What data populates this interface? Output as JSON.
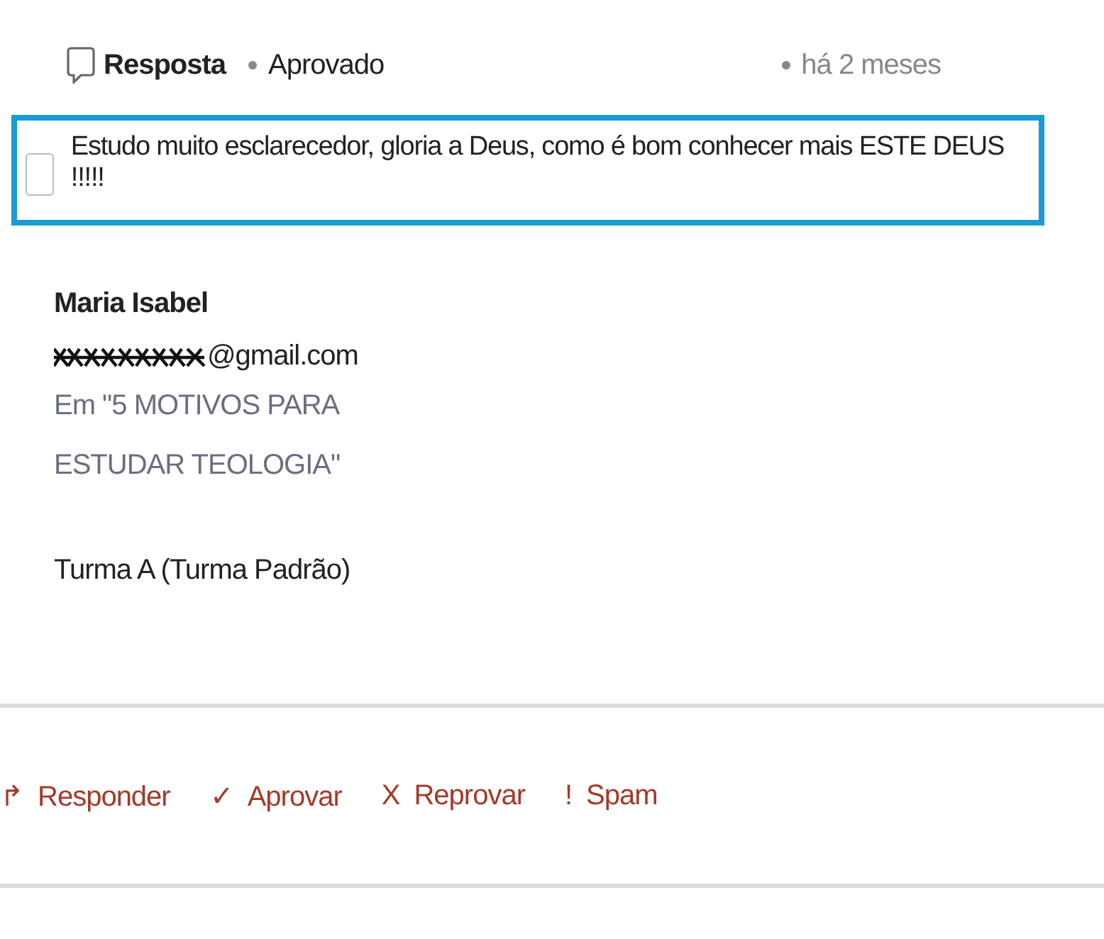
{
  "header": {
    "type": "Resposta",
    "status": "Aprovado",
    "time": "há 2 meses"
  },
  "comment": {
    "checked": false,
    "text": "Estudo muito esclarecedor, gloria a Deus, como é bom conhecer mais ESTE DEUS !!!!!"
  },
  "author": {
    "name": "Maria Isabel",
    "email": "@gmail.com",
    "post": "Em \"5 MOTIVOS PARA ESTUDAR TEOLOGIA\"",
    "group": "Turma A (Turma Padrão)"
  },
  "actions": [
    {
      "icon": "↱",
      "label": "Responder"
    },
    {
      "icon": "✓",
      "label": "Aprovar"
    },
    {
      "icon": "X",
      "label": "Reprovar"
    },
    {
      "icon": "!",
      "label": "Spam"
    }
  ]
}
